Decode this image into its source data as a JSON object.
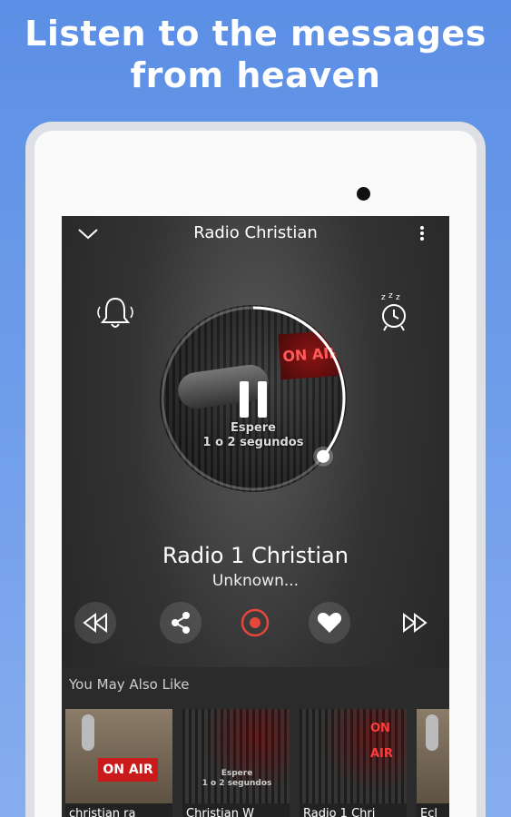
{
  "headline": {
    "line1": "Listen to the messages",
    "line2": "from heaven"
  },
  "player": {
    "title": "Radio Christian",
    "overlay_line1": "Espere",
    "overlay_line2": "1 o 2 segundos",
    "artwork_sign": "ON AIR",
    "station": "Radio 1 Christian",
    "track": "Unknown...",
    "progress_fraction": 0.36,
    "controls": [
      "rewind-icon",
      "share-icon",
      "record-icon",
      "heart-icon",
      "fast-forward-icon"
    ],
    "colors": {
      "record": "#e5473a",
      "accent": "#ffffff"
    }
  },
  "recommend": {
    "title": "You May Also Like",
    "items": [
      {
        "label": "christian ra",
        "sign": "ON AIR"
      },
      {
        "label": "Christian W",
        "wait1": "Espere",
        "wait2": "1 o 2 segundos"
      },
      {
        "label": "Radio 1 Chri",
        "sign": "ON AIR"
      },
      {
        "label": "Ecl"
      }
    ]
  }
}
